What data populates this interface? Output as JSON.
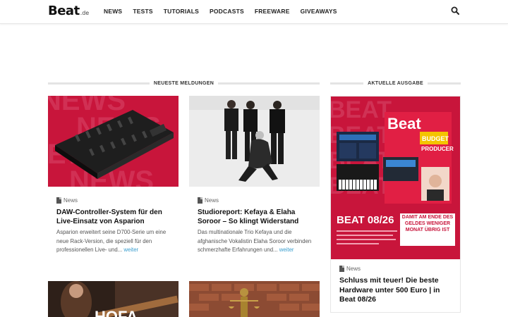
{
  "header": {
    "logo_main": "Beat",
    "logo_sub": ".de",
    "nav": [
      "NEWS",
      "TESTS",
      "TUTORIALS",
      "PODCASTS",
      "FREEWARE",
      "GIVEAWAYS"
    ]
  },
  "sections": {
    "news_title": "NEUESTE MELDUNGEN",
    "issue_title": "AKTUELLE AUSGABE"
  },
  "cards": [
    {
      "image_text": "NEWS",
      "category": "News",
      "title": "DAW-Controller-System für den Live-Einsatz von Asparion",
      "text": "Asparion erweitert seine D700-Serie um eine neue Rack-Version, die speziell für den professionellen Live- und...",
      "more": "weiter"
    },
    {
      "category": "News",
      "title": "Studioreport: Kefaya & Elaha Soroor – So klingt Widerstand",
      "text": "Das multinationale Trio Kefaya und die afghanische Vokalistin Elaha Soroor verbinden schmerzhafte Erfahrungen und...",
      "more": "weiter"
    },
    {
      "category": "News",
      "title": "Schluss mit teuer! Die beste Hard­ware unter 500 Euro | in Beat 08/26",
      "cover": {
        "brand": "Beat",
        "headline_1": "BUDGET",
        "headline_2": "PRODUCER",
        "issue": "BEAT 08/26",
        "teaser": "DAMIT AM ENDE DES GELDES WENIGER MONAT ÜBRIG IST",
        "watermark": "BEAT"
      }
    },
    {
      "image_text": "HOFA"
    },
    {}
  ],
  "colors": {
    "accent": "#c8153b",
    "link": "#3a9ecf"
  }
}
